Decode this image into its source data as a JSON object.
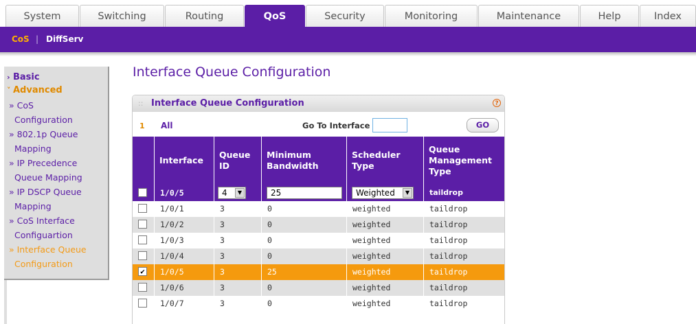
{
  "tabs": [
    "System",
    "Switching",
    "Routing",
    "QoS",
    "Security",
    "Monitoring",
    "Maintenance",
    "Help",
    "Index"
  ],
  "active_tab": "QoS",
  "subnav": {
    "cos": "CoS",
    "separator": "|",
    "diffserv": "DiffServ"
  },
  "sidebar": {
    "basic": "Basic",
    "advanced": "Advanced",
    "items": [
      "» CoS",
      "Configuration",
      "» 802.1p Queue",
      "Mapping",
      "» IP Precedence",
      "Queue Mapping",
      "» IP DSCP Queue",
      "Mapping",
      "» CoS Interface",
      "Configuartion",
      "» Interface Queue",
      "Configuration"
    ]
  },
  "page_title": "Interface Queue Configuration",
  "panel": {
    "title": "Interface Queue Configuration",
    "help_icon": "?",
    "index": "1",
    "all_label": "All",
    "goto_label": "Go To Interface",
    "goto_value": "",
    "go_button": "GO"
  },
  "table": {
    "headers": [
      "Interface",
      "Queue ID",
      "Minimum Bandwidth",
      "Scheduler Type",
      "Queue Management Type"
    ],
    "edit_row": {
      "interface": "1/0/5",
      "queue_id": "4",
      "min_bandwidth": "25",
      "scheduler": "Weighted",
      "mgmt": "taildrop"
    },
    "rows": [
      {
        "checked": false,
        "interface": "1/0/1",
        "queue_id": "3",
        "min_bandwidth": "0",
        "scheduler": "weighted",
        "mgmt": "taildrop"
      },
      {
        "checked": false,
        "interface": "1/0/2",
        "queue_id": "3",
        "min_bandwidth": "0",
        "scheduler": "weighted",
        "mgmt": "taildrop"
      },
      {
        "checked": false,
        "interface": "1/0/3",
        "queue_id": "3",
        "min_bandwidth": "0",
        "scheduler": "weighted",
        "mgmt": "taildrop"
      },
      {
        "checked": false,
        "interface": "1/0/4",
        "queue_id": "3",
        "min_bandwidth": "0",
        "scheduler": "weighted",
        "mgmt": "taildrop"
      },
      {
        "checked": true,
        "interface": "1/0/5",
        "queue_id": "3",
        "min_bandwidth": "25",
        "scheduler": "weighted",
        "mgmt": "taildrop"
      },
      {
        "checked": false,
        "interface": "1/0/6",
        "queue_id": "3",
        "min_bandwidth": "0",
        "scheduler": "weighted",
        "mgmt": "taildrop"
      },
      {
        "checked": false,
        "interface": "1/0/7",
        "queue_id": "3",
        "min_bandwidth": "0",
        "scheduler": "weighted",
        "mgmt": "taildrop"
      }
    ]
  },
  "colors": {
    "brand": "#5b1ea6",
    "accent": "#f59a0e",
    "alt_row": "#e0e0e0"
  }
}
